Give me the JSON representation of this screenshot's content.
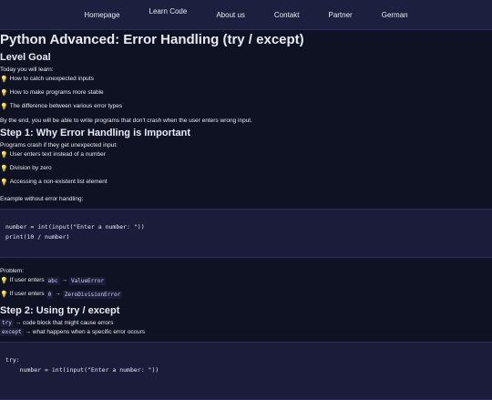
{
  "nav": {
    "items": [
      "Homepage",
      "Learn Code",
      "About us",
      "Contakt",
      "Partner",
      "German"
    ]
  },
  "title": "Python Advanced: Error Handling (try / except)",
  "level_goal": {
    "heading": "Level Goal",
    "intro": "Today you will learn:",
    "bullets": [
      "How to catch unexpected inputs",
      "How to make programs more stable",
      "The difference between various error types"
    ],
    "outro": "By the end, you will be able to write programs that don't crash when the user enters wrong input."
  },
  "step1": {
    "heading": "Step 1: Why Error Handling is Important",
    "intro": "Programs crash if they get unexpected input:",
    "bullets": [
      "User enters text instead of a number",
      "Division by zero",
      "Accessing a non-existent list element"
    ],
    "example_label": "Example without error handling:",
    "code": [
      "number = int(input(\"Enter a number: \"))",
      "print(10 / number)"
    ]
  },
  "problem": {
    "label": "Problem:",
    "items": [
      {
        "prefix": "If user enters",
        "input": "abc",
        "arrow": "→",
        "error": "ValueError"
      },
      {
        "prefix": "If user enters",
        "input": "0",
        "arrow": "→",
        "error": "ZeroDivisionError"
      }
    ]
  },
  "step2": {
    "heading": "Step 2: Using try / except",
    "defs": [
      {
        "keyword": "try",
        "text": "→ code block that might cause errors"
      },
      {
        "keyword": "except",
        "text": "→ what happens when a specific error occurs"
      }
    ],
    "code": [
      "try:",
      "    number = int(input(\"Enter a number: \"))"
    ]
  },
  "colors": {
    "background": "#0f1222",
    "nav": "#1d1f3f",
    "code_bg": "#1b1c3a",
    "bulb": "#ffd54a"
  },
  "icons": {
    "bullet": "lightbulb-icon"
  }
}
